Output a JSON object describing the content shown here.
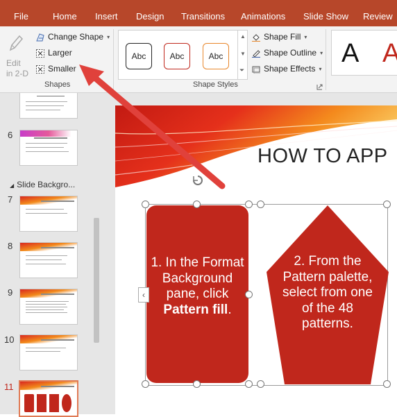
{
  "ribbon_tabs": [
    "File",
    "Home",
    "Insert",
    "Design",
    "Transitions",
    "Animations",
    "Slide Show",
    "Review"
  ],
  "shapes_group": {
    "edit_2d": "Edit\nin 2-D",
    "change_shape": "Change Shape",
    "larger": "Larger",
    "smaller": "Smaller",
    "label": "Shapes"
  },
  "shape_styles_group": {
    "styles": [
      "Abc",
      "Abc",
      "Abc"
    ],
    "shape_fill": "Shape Fill",
    "shape_outline": "Shape Outline",
    "shape_effects": "Shape Effects",
    "label": "Shape Styles"
  },
  "wordart_letters": [
    "A",
    "A"
  ],
  "slide_panel": {
    "section_name": "Slide Backgro...",
    "slide_numbers": [
      "6",
      "7",
      "8",
      "9",
      "10",
      "11"
    ]
  },
  "slide": {
    "title": "HOW TO APP",
    "box1_line1": "1. In the Format Background pane, click",
    "box1_bold": "Pattern fill",
    "box1_end": ".",
    "box2": "2. From the Pattern palette, select from one of the 48 patterns."
  },
  "colors": {
    "tab_bar": "#b7472a",
    "shape_fill": "#c0271c",
    "arrow": "#e0413b"
  }
}
